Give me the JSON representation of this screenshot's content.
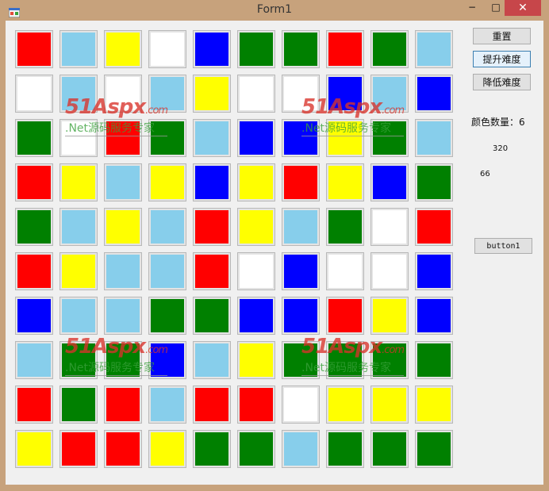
{
  "window": {
    "title": "Form1",
    "minimize": "−",
    "maximize": "□",
    "close": "✕"
  },
  "colors": {
    "R": "#ff0000",
    "S": "#87ceeb",
    "Y": "#ffff00",
    "W": "#ffffff",
    "B": "#0000ff",
    "G": "#008000"
  },
  "board": {
    "rows": [
      [
        "R",
        "S",
        "Y",
        "W",
        "B",
        "G",
        "G",
        "R",
        "G",
        "S"
      ],
      [
        "W",
        "S",
        "W",
        "S",
        "Y",
        "W",
        "W",
        "B",
        "S",
        "B"
      ],
      [
        "G",
        "W",
        "R",
        "G",
        "S",
        "B",
        "B",
        "Y",
        "G",
        "S"
      ],
      [
        "R",
        "Y",
        "S",
        "Y",
        "B",
        "Y",
        "R",
        "Y",
        "B",
        "G"
      ],
      [
        "G",
        "S",
        "Y",
        "S",
        "R",
        "Y",
        "S",
        "G",
        "W",
        "R"
      ],
      [
        "R",
        "Y",
        "S",
        "S",
        "R",
        "W",
        "B",
        "W",
        "W",
        "B"
      ],
      [
        "B",
        "S",
        "S",
        "G",
        "G",
        "B",
        "B",
        "R",
        "Y",
        "B"
      ],
      [
        "S",
        "G",
        "G",
        "B",
        "S",
        "Y",
        "G",
        "G",
        "G",
        "G"
      ],
      [
        "R",
        "G",
        "R",
        "S",
        "R",
        "R",
        "W",
        "Y",
        "Y",
        "Y"
      ],
      [
        "Y",
        "R",
        "R",
        "Y",
        "G",
        "G",
        "S",
        "G",
        "G",
        "G"
      ]
    ]
  },
  "buttons": {
    "reset": "重置",
    "harder": "提升难度",
    "easier": "降低难度",
    "button1": "button1"
  },
  "labels": {
    "color_count": "颜色数量：6",
    "value1": "320",
    "value2": "66"
  },
  "watermark": {
    "main": "51Aspx",
    "suffix": ".com",
    "tagline": ".Net源码服务专家"
  }
}
